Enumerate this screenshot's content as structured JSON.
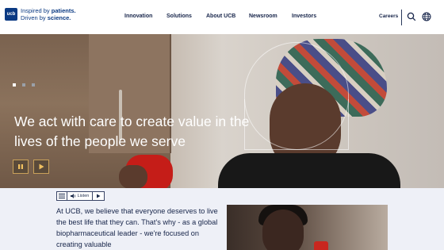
{
  "header": {
    "logo_abbr": "ucb",
    "logo_line1_prefix": "Inspired by ",
    "logo_line1_emph": "patients.",
    "logo_line2_prefix": "Driven by ",
    "logo_line2_emph": "science.",
    "nav": [
      "Innovation",
      "Solutions",
      "About UCB",
      "Newsroom",
      "Investors"
    ],
    "careers": "Careers",
    "icons": [
      "search-icon",
      "globe-icon"
    ]
  },
  "hero": {
    "title": "We act with care to create value in the lives of the people we serve",
    "slides": {
      "total": 3,
      "active": 1
    },
    "controls": [
      "pause-icon",
      "play-icon"
    ]
  },
  "listen": {
    "menu_icon": "menu-icon",
    "speaker_icon": "speaker-icon",
    "label": "Listen",
    "play_icon": "play-icon"
  },
  "intro": {
    "text": "At UCB, we believe that everyone deserves to live the best life that they can. That's why - as a global biopharmaceutical leader - we're focused on creating valuable"
  },
  "colors": {
    "brand": "#0b3a83",
    "nav_text": "#17254a",
    "lower_bg": "#eef0f7",
    "control_border": "#c9a15a"
  }
}
